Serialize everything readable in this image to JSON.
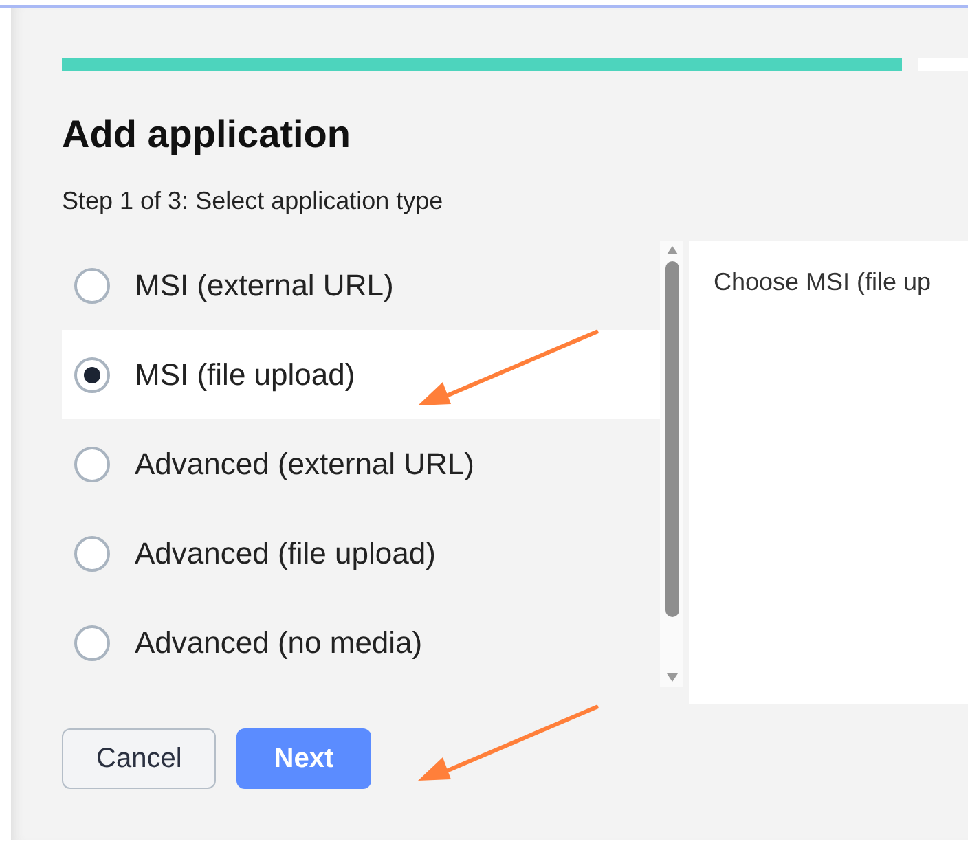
{
  "dialog": {
    "progress": {
      "level": 0.89
    },
    "title": "Add application",
    "step": "Step 1 of 3: Select application type",
    "options": [
      {
        "label": "MSI (external URL)",
        "selected": false
      },
      {
        "label": "MSI (file upload)",
        "selected": true
      },
      {
        "label": "Advanced (external URL)",
        "selected": false
      },
      {
        "label": "Advanced (file upload)",
        "selected": false
      },
      {
        "label": "Advanced (no media)",
        "selected": false
      }
    ],
    "description": "Choose MSI (file up",
    "buttons": [
      {
        "label": "Cancel",
        "kind": "secondary"
      },
      {
        "label": "Next",
        "kind": "primary"
      }
    ]
  }
}
